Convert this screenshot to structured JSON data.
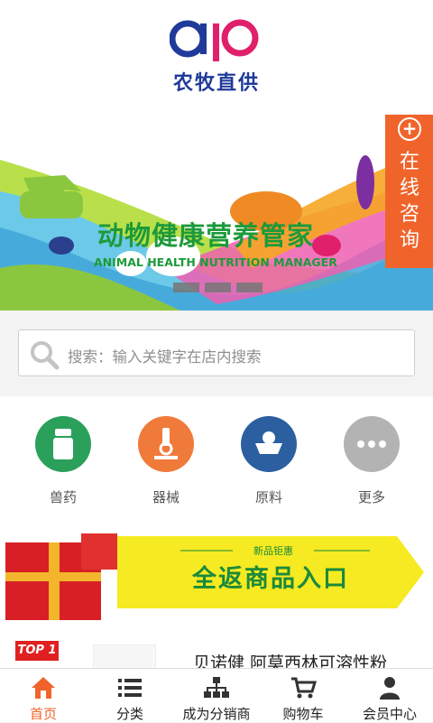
{
  "header": {
    "brand_name": "农牧直供",
    "logo_icon": "ap-logo-icon"
  },
  "banner": {
    "title": "动物健康营养管家",
    "subtitle": "ANIMAL HEALTH NUTRITION MANAGER",
    "slides_total": 3,
    "active_slide": 1
  },
  "consult": {
    "label": "在线咨询",
    "icon": "plus-circle-icon"
  },
  "search": {
    "placeholder": "搜索：输入关键字在店内搜索",
    "icon": "search-icon"
  },
  "categories": [
    {
      "label": "兽药",
      "color": "#2aa05a",
      "icon": "medicine-bottle-icon"
    },
    {
      "label": "器械",
      "color": "#f07a3a",
      "icon": "microscope-icon"
    },
    {
      "label": "原料",
      "color": "#2b5fa0",
      "icon": "feed-bowl-icon"
    },
    {
      "label": "更多",
      "color": "#b3b3b3",
      "icon": "more-dots-icon"
    }
  ],
  "promo": {
    "tag": "新品钜惠",
    "main": "全返商品入口"
  },
  "top_product": {
    "badge": "TOP 1",
    "name": "贝诺健 阿莫西林可溶性粉"
  },
  "colors": {
    "accent": "#f0642b",
    "brand_blue": "#1f3a99",
    "brand_green": "#1d9a3a"
  },
  "tabs": [
    {
      "label": "首页",
      "icon": "home-icon",
      "active": true
    },
    {
      "label": "分类",
      "icon": "list-icon",
      "active": false
    },
    {
      "label": "成为分销商",
      "icon": "org-chart-icon",
      "active": false
    },
    {
      "label": "购物车",
      "icon": "cart-icon",
      "active": false
    },
    {
      "label": "会员中心",
      "icon": "user-icon",
      "active": false
    }
  ]
}
